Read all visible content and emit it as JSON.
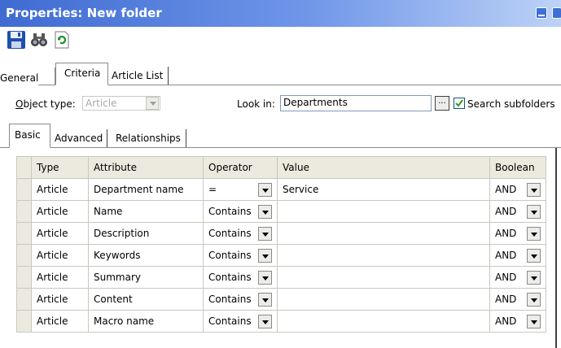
{
  "window": {
    "title": "Properties: New folder"
  },
  "toolbar": {
    "save_icon": "floppy-disk-icon",
    "find_icon": "binoculars-icon",
    "refresh_icon": "refresh-icon"
  },
  "tabs": [
    {
      "label": "General"
    },
    {
      "label": "Criteria",
      "active": true
    },
    {
      "label": "Article List"
    }
  ],
  "criteria": {
    "object_type_label": "Object type:",
    "object_type_value": "Article",
    "look_in_label": "Look in:",
    "look_in_value": "Departments",
    "browse_label": "...",
    "search_subfolders_label": "Search subfolders",
    "search_subfolders_checked": true
  },
  "subtabs": [
    {
      "label": "Basic",
      "active": true
    },
    {
      "label": "Advanced"
    },
    {
      "label": "Relationships"
    }
  ],
  "grid": {
    "columns": [
      "Type",
      "Attribute",
      "Operator",
      "Value",
      "Boolean"
    ],
    "rows": [
      {
        "type": "Article",
        "attribute": "Department name",
        "operator": "=",
        "value": "Service",
        "boolean": "AND"
      },
      {
        "type": "Article",
        "attribute": "Name",
        "operator": "Contains",
        "value": "",
        "boolean": "AND"
      },
      {
        "type": "Article",
        "attribute": "Description",
        "operator": "Contains",
        "value": "",
        "boolean": "AND"
      },
      {
        "type": "Article",
        "attribute": "Keywords",
        "operator": "Contains",
        "value": "",
        "boolean": "AND"
      },
      {
        "type": "Article",
        "attribute": "Summary",
        "operator": "Contains",
        "value": "",
        "boolean": "AND"
      },
      {
        "type": "Article",
        "attribute": "Content",
        "operator": "Contains",
        "value": "",
        "boolean": "AND"
      },
      {
        "type": "Article",
        "attribute": "Macro name",
        "operator": "Contains",
        "value": "",
        "boolean": "AND"
      }
    ]
  }
}
